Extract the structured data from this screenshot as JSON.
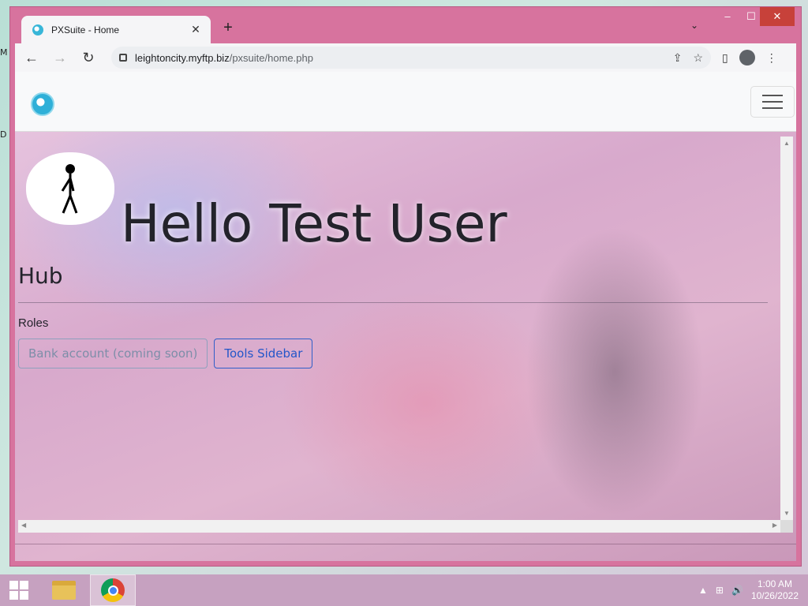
{
  "desktop": {
    "glyph_top": "M",
    "glyph_mid": "D"
  },
  "browser": {
    "tab_title": "PXSuite - Home",
    "tab_close": "✕",
    "new_tab": "+",
    "tab_search": "⌄",
    "window_controls": {
      "minimize": "–",
      "maximize": "☐",
      "close": "✕"
    },
    "nav": {
      "back": "←",
      "forward": "→",
      "reload": "↻"
    },
    "url_host": "leightoncity.myftp.biz",
    "url_path": "/pxsuite/home.php",
    "omnibox_icons": {
      "share": "⇪",
      "bookmark": "☆"
    },
    "toolbar_icons": {
      "side_panel": "▯",
      "menu": "⋮"
    }
  },
  "page": {
    "greeting": "Hello Test User",
    "hub_title": "Hub",
    "roles_label": "Roles",
    "roles": [
      {
        "label": "Bank account (coming soon)",
        "state": "disabled"
      },
      {
        "label": "Tools Sidebar",
        "state": "enabled"
      }
    ]
  },
  "scrollbars": {
    "up": "▲",
    "down": "▼",
    "left": "◀",
    "right": "▶"
  },
  "taskbar": {
    "tray_icons": {
      "show_hidden": "▲",
      "network": "⊞",
      "volume": "🔊"
    },
    "time": "1:00 AM",
    "date": "10/26/2022"
  },
  "colors": {
    "window_frame": "#d7739e",
    "close_button": "#c7413a",
    "taskbar": "#c6a1c0",
    "role_link": "#2456c9"
  }
}
